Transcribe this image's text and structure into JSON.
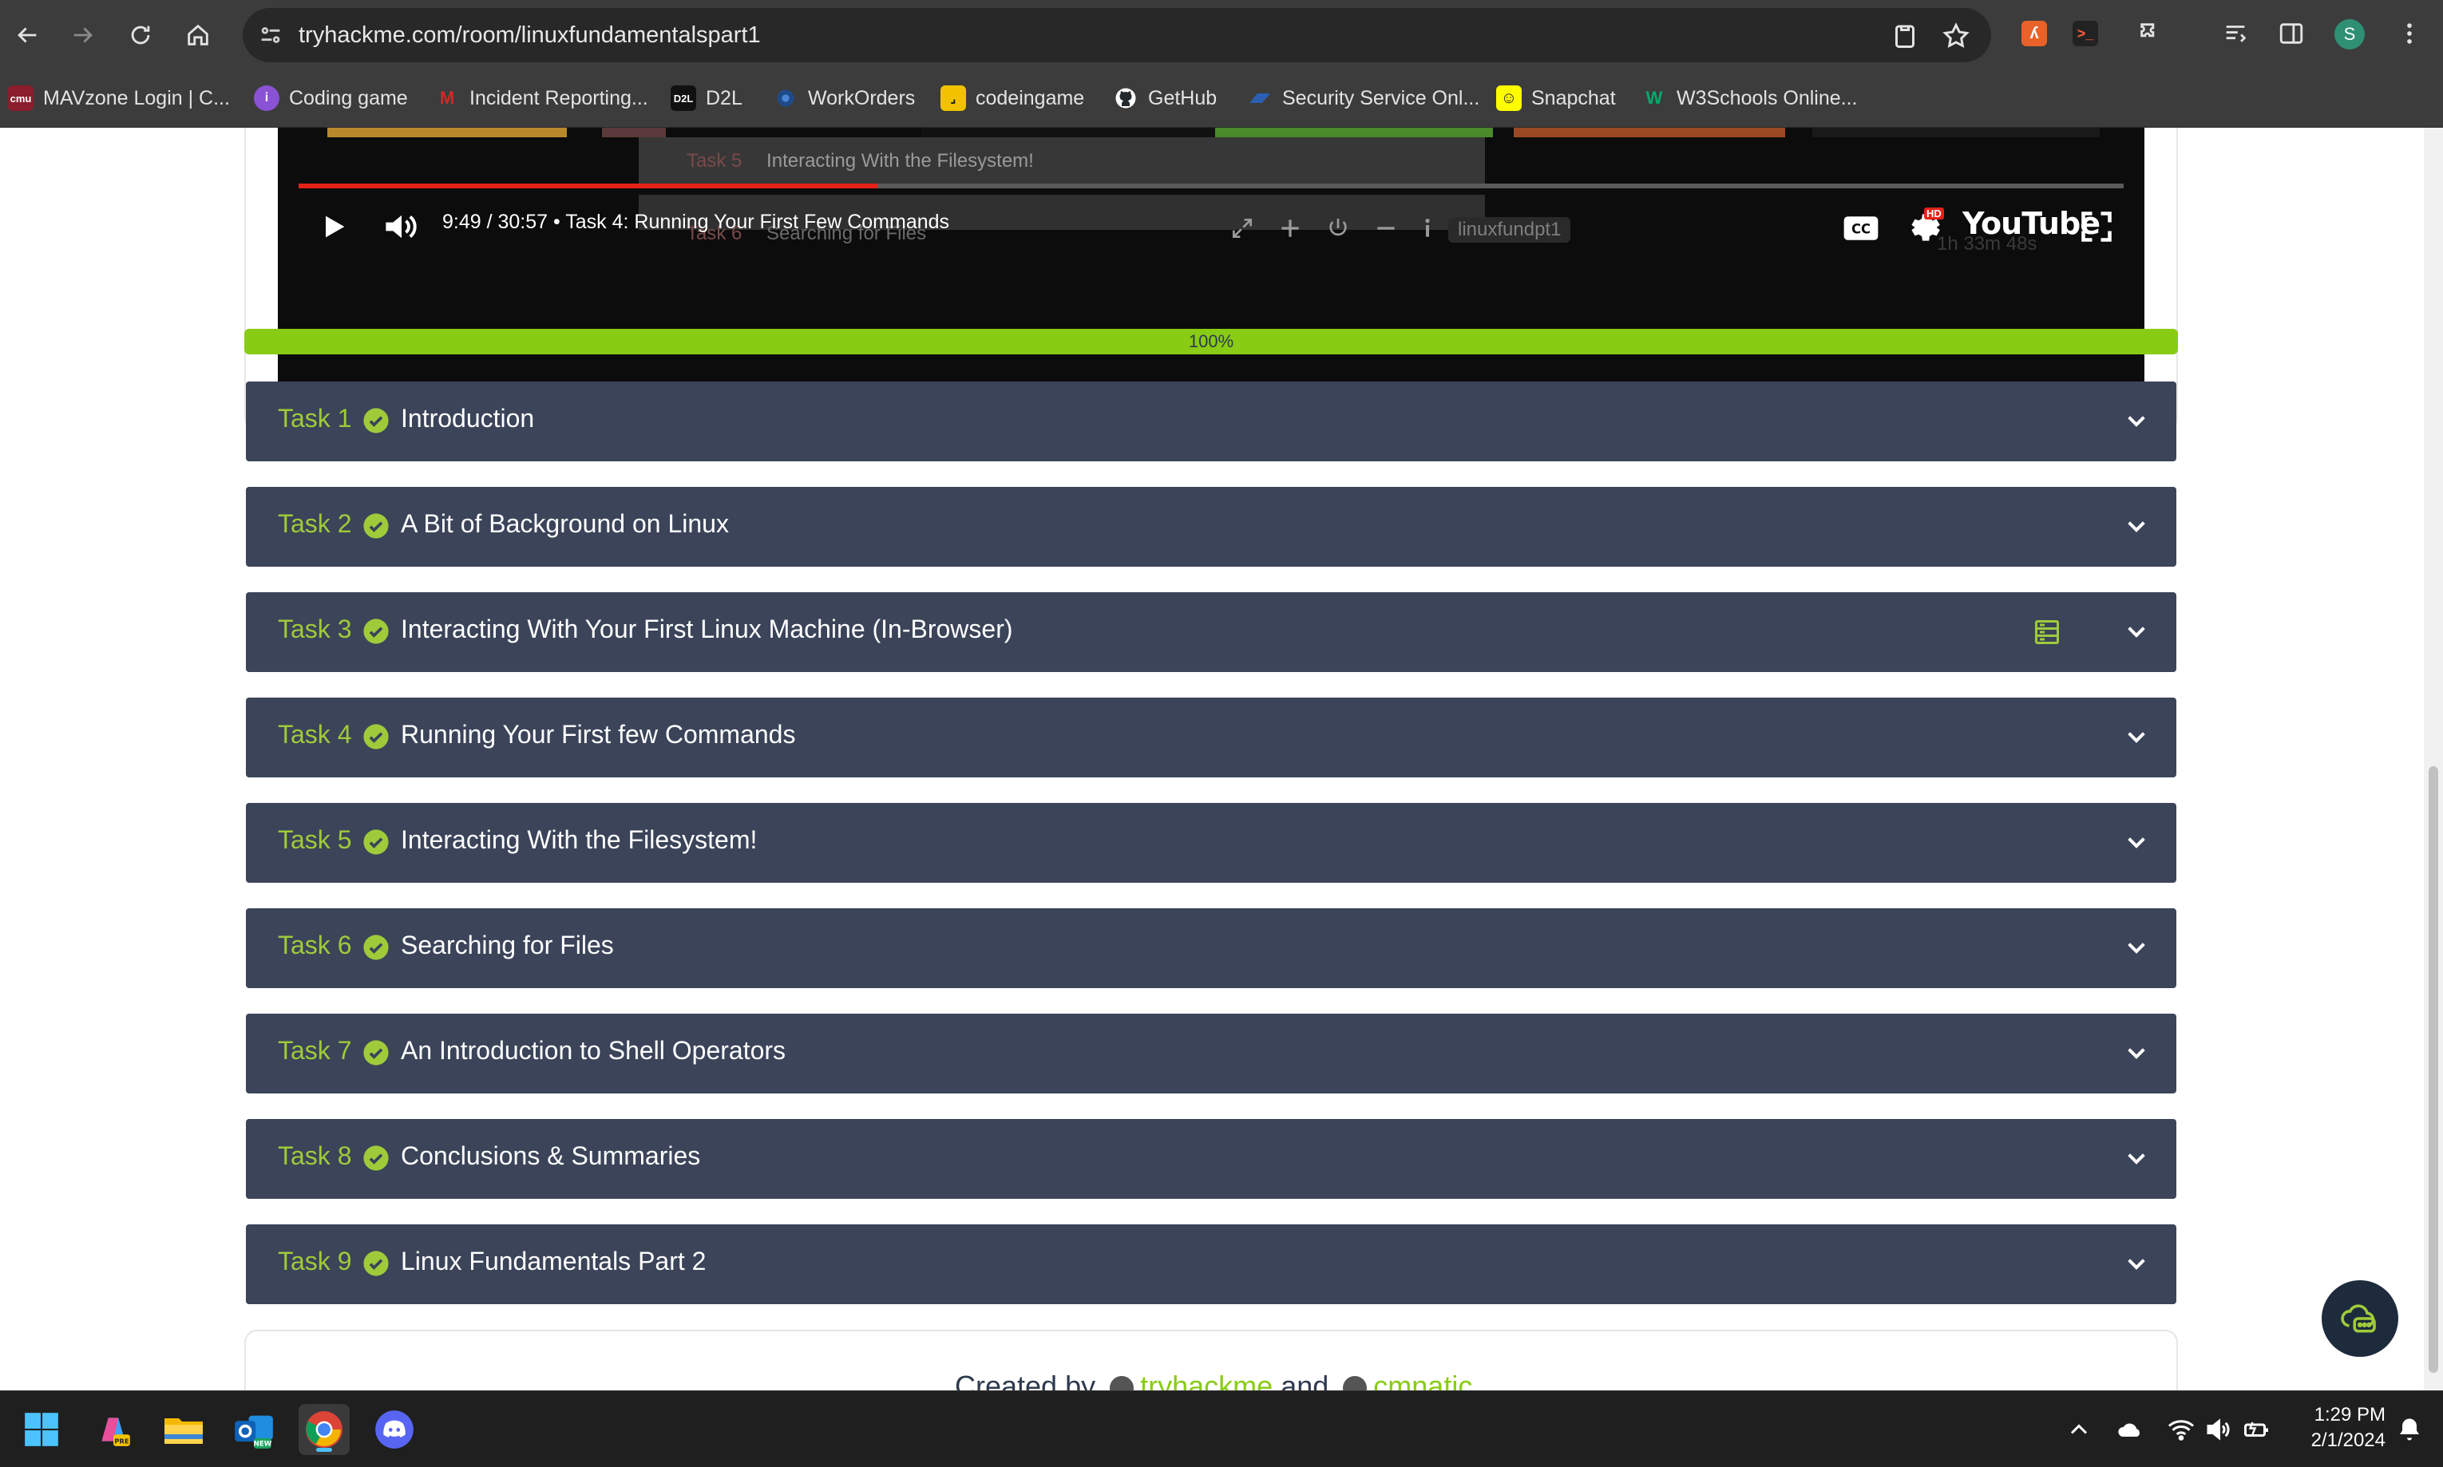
{
  "browser": {
    "url": "tryhackme.com/room/linuxfundamentalspart1",
    "bookmarks": [
      {
        "label": "MAVzone Login | C...",
        "icon": "cmu-logo-icon",
        "color": "#8b1d2c"
      },
      {
        "label": "Coding game",
        "icon": "coding-game-icon",
        "color": "#8a52d4"
      },
      {
        "label": "Incident Reporting...",
        "icon": "incident-icon",
        "color": "#b0202a"
      },
      {
        "label": "D2L",
        "icon": "d2l-icon",
        "color": "#111111"
      },
      {
        "label": "WorkOrders",
        "icon": "workorders-icon",
        "color": "#1f4a8a"
      },
      {
        "label": "codeingame",
        "icon": "codingame-icon",
        "color": "#f2c200"
      },
      {
        "label": "GetHub",
        "icon": "github-icon",
        "color": "#24292e"
      },
      {
        "label": "Security Service Onl...",
        "icon": "security-service-icon",
        "color": "#2b5fb3"
      },
      {
        "label": "Snapchat",
        "icon": "snapchat-icon",
        "color": "#fffc00"
      },
      {
        "label": "W3Schools Online...",
        "icon": "w3schools-icon",
        "color": "#04aa6d"
      }
    ],
    "profile_initial": "S"
  },
  "video": {
    "overlay_task_top": "Task 5",
    "overlay_task_top_title": "Interacting With the Filesystem!",
    "overlay_task_bottom": "Task 6",
    "overlay_task_bottom_title": "Searching for Files",
    "time": "9:49 / 30:57",
    "chapter": "Task 4: Running Your First Few Commands",
    "machine_name": "linuxfundpt1",
    "progress_fraction": 0.317,
    "hd_badge": "HD",
    "brand": "YouTube",
    "timer_ghost": "1h 33m 48s"
  },
  "room": {
    "overall_progress_label": "100%",
    "overall_progress_fraction": 1.0,
    "tasks": [
      {
        "number": "Task 1",
        "title": "Introduction",
        "completed": true
      },
      {
        "number": "Task 2",
        "title": "A Bit of Background on Linux",
        "completed": true
      },
      {
        "number": "Task 3",
        "title": "Interacting With Your First Linux Machine (In-Browser)",
        "completed": true,
        "has_machine_icon": true
      },
      {
        "number": "Task 4",
        "title": "Running Your First few Commands",
        "completed": true
      },
      {
        "number": "Task 5",
        "title": "Interacting With the Filesystem!",
        "completed": true
      },
      {
        "number": "Task 6",
        "title": "Searching for Files",
        "completed": true
      },
      {
        "number": "Task 7",
        "title": "An Introduction to Shell Operators",
        "completed": true
      },
      {
        "number": "Task 8",
        "title": "Conclusions & Summaries",
        "completed": true
      },
      {
        "number": "Task 9",
        "title": "Linux Fundamentals Part 2",
        "completed": true
      }
    ],
    "footer": {
      "prefix": "Created by",
      "author1": "tryhackme",
      "and": "and",
      "author2": "cmnatic"
    }
  },
  "colors": {
    "task_bg": "#3b4459",
    "task_accent": "#9fcb3a",
    "progress": "#88cc14"
  },
  "taskbar": {
    "time": "1:29 PM",
    "date": "2/1/2024",
    "apps": [
      "windows-start-icon",
      "copilot-icon",
      "file-explorer-icon",
      "outlook-icon",
      "chrome-icon",
      "discord-icon"
    ]
  }
}
